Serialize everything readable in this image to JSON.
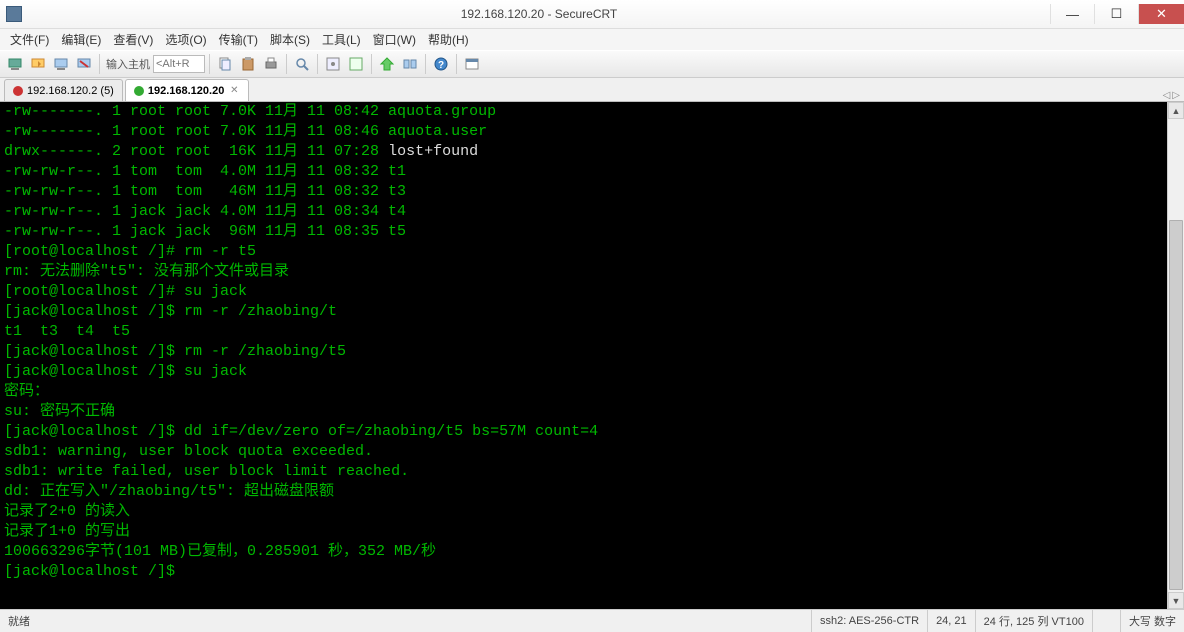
{
  "window": {
    "title": "192.168.120.20 - SecureCRT"
  },
  "menu": {
    "file": "文件(F)",
    "edit": "编辑(E)",
    "view": "查看(V)",
    "options": "选项(O)",
    "transfer": "传输(T)",
    "script": "脚本(S)",
    "tools": "工具(L)",
    "window": "窗口(W)",
    "help": "帮助(H)"
  },
  "toolbar": {
    "host_label": "输入主机",
    "host_placeholder": "<Alt+R"
  },
  "tabs": {
    "t1_label": "192.168.120.2 (5)",
    "t2_label": "192.168.120.20"
  },
  "terminal_lines": [
    {
      "segs": [
        {
          "c": "g",
          "t": "-rw-------. 1 root root 7.0K 11月 11 08:42 aquota.group"
        }
      ]
    },
    {
      "segs": [
        {
          "c": "g",
          "t": "-rw-------. 1 root root 7.0K 11月 11 08:46 aquota.user"
        }
      ]
    },
    {
      "segs": [
        {
          "c": "g",
          "t": "drwx------. 2 root root  16K 11月 11 07:28 "
        },
        {
          "c": "w",
          "t": "lost+found"
        }
      ]
    },
    {
      "segs": [
        {
          "c": "g",
          "t": "-rw-rw-r--. 1 tom  tom  4.0M 11月 11 08:32 t1"
        }
      ]
    },
    {
      "segs": [
        {
          "c": "g",
          "t": "-rw-rw-r--. 1 tom  tom   46M 11月 11 08:32 t3"
        }
      ]
    },
    {
      "segs": [
        {
          "c": "g",
          "t": "-rw-rw-r--. 1 jack jack 4.0M 11月 11 08:34 t4"
        }
      ]
    },
    {
      "segs": [
        {
          "c": "g",
          "t": "-rw-rw-r--. 1 jack jack  96M 11月 11 08:35 t5"
        }
      ]
    },
    {
      "segs": [
        {
          "c": "g",
          "t": "[root@localhost /]# rm -r t5"
        }
      ]
    },
    {
      "segs": [
        {
          "c": "g",
          "t": "rm: 无法删除\"t5\": 没有那个文件或目录"
        }
      ]
    },
    {
      "segs": [
        {
          "c": "g",
          "t": "[root@localhost /]# su jack"
        }
      ]
    },
    {
      "segs": [
        {
          "c": "g",
          "t": "[jack@localhost /]$ rm -r /zhaobing/t"
        }
      ]
    },
    {
      "segs": [
        {
          "c": "g",
          "t": "t1  t3  t4  t5"
        }
      ]
    },
    {
      "segs": [
        {
          "c": "g",
          "t": "[jack@localhost /]$ rm -r /zhaobing/t5"
        }
      ]
    },
    {
      "segs": [
        {
          "c": "g",
          "t": "[jack@localhost /]$ su jack"
        }
      ]
    },
    {
      "segs": [
        {
          "c": "g",
          "t": "密码："
        }
      ]
    },
    {
      "segs": [
        {
          "c": "g",
          "t": "su: 密码不正确"
        }
      ]
    },
    {
      "segs": [
        {
          "c": "g",
          "t": "[jack@localhost /]$ dd if=/dev/zero of=/zhaobing/t5 bs=57M count=4"
        }
      ]
    },
    {
      "segs": [
        {
          "c": "g",
          "t": "sdb1: warning, user block quota exceeded."
        }
      ]
    },
    {
      "segs": [
        {
          "c": "g",
          "t": "sdb1: write failed, user block limit reached."
        }
      ]
    },
    {
      "segs": [
        {
          "c": "g",
          "t": "dd: 正在写入\"/zhaobing/t5\": 超出磁盘限额"
        }
      ]
    },
    {
      "segs": [
        {
          "c": "g",
          "t": "记录了2+0 的读入"
        }
      ]
    },
    {
      "segs": [
        {
          "c": "g",
          "t": "记录了1+0 的写出"
        }
      ]
    },
    {
      "segs": [
        {
          "c": "g",
          "t": "100663296字节(101 MB)已复制，0.285901 秒，352 MB/秒"
        }
      ]
    },
    {
      "segs": [
        {
          "c": "g",
          "t": "[jack@localhost /]$ "
        }
      ]
    }
  ],
  "status": {
    "ready": "就绪",
    "proto": "ssh2: AES-256-CTR",
    "pos": "24,  21",
    "size": "24 行, 125 列 VT100",
    "caps": "大写 数字"
  }
}
